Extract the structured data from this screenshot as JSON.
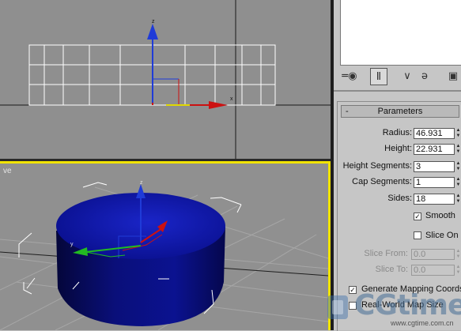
{
  "viewport_front": {
    "axis_z": "z",
    "axis_x": "x"
  },
  "viewport_perspective": {
    "label": "ve",
    "axis_z": "z",
    "axis_y": "y"
  },
  "command_panel": {
    "tabs": [
      {
        "name": "pin-icon",
        "glyph": "═◉"
      },
      {
        "name": "modifier-stack-icon",
        "glyph": "Ⅱ"
      },
      {
        "name": "funnel-icon",
        "glyph": "∨"
      },
      {
        "name": "remove-modifier-icon",
        "glyph": "ə"
      },
      {
        "name": "configure-icon",
        "glyph": "▣"
      }
    ],
    "rollout": {
      "collapse": "-",
      "title": "Parameters",
      "fields": [
        {
          "label": "Radius:",
          "value": "46.931",
          "enabled": true
        },
        {
          "label": "Height:",
          "value": "22.931",
          "enabled": true
        },
        {
          "label": "Height Segments:",
          "value": "3",
          "enabled": true
        },
        {
          "label": "Cap Segments:",
          "value": "1",
          "enabled": true
        },
        {
          "label": "Sides:",
          "value": "18",
          "enabled": true
        }
      ],
      "smooth": {
        "label": "Smooth",
        "checked": true,
        "mark": "✓"
      },
      "slice_on": {
        "label": "Slice On",
        "checked": false
      },
      "slice_fields": [
        {
          "label": "Slice From:",
          "value": "0.0",
          "enabled": false
        },
        {
          "label": "Slice To:",
          "value": "0.0",
          "enabled": false
        }
      ],
      "gen_mapping": {
        "label": "Generate Mapping Coords.",
        "checked": true,
        "mark": "✓"
      },
      "real_world": {
        "label": "Real-World Map Size",
        "checked": false
      }
    }
  },
  "watermark": {
    "brand": "CGtime",
    "url": "www.cgtime.com.cn"
  },
  "colors": {
    "active_border": "#f2e400",
    "cylinder": "#0a0f8c",
    "viewport_bg": "#909090"
  }
}
